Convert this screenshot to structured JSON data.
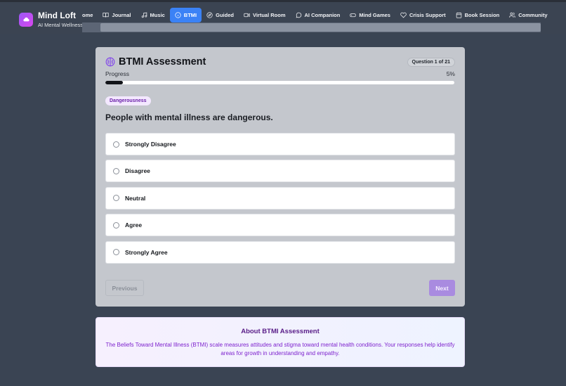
{
  "brand": {
    "title": "Mind Loft",
    "subtitle": "AI Mental Wellness"
  },
  "nav": {
    "items": [
      {
        "label": "ome",
        "icon": "home-icon"
      },
      {
        "label": "Journal",
        "icon": "book-icon"
      },
      {
        "label": "Music",
        "icon": "music-icon"
      },
      {
        "label": "BTMI",
        "icon": "info-icon",
        "active": true
      },
      {
        "label": "Guided",
        "icon": "compass-icon"
      },
      {
        "label": "Virtual Room",
        "icon": "video-icon"
      },
      {
        "label": "AI Companion",
        "icon": "chat-icon"
      },
      {
        "label": "Mind Games",
        "icon": "gamepad-icon"
      },
      {
        "label": "Crisis Support",
        "icon": "heart-icon"
      },
      {
        "label": "Book Session",
        "icon": "calendar-icon"
      },
      {
        "label": "Community",
        "icon": "users-icon"
      }
    ]
  },
  "assessment": {
    "title": "BTMI Assessment",
    "question_counter": "Question 1 of 21",
    "progress_label": "Progress",
    "progress_text": "5%",
    "progress_fraction": 0.05,
    "category": "Dangerousness",
    "question": "People with mental illness are dangerous.",
    "options": [
      "Strongly Disagree",
      "Disagree",
      "Neutral",
      "Agree",
      "Strongly Agree"
    ],
    "previous_label": "Previous",
    "next_label": "Next"
  },
  "about": {
    "title": "About BTMI Assessment",
    "text": "The Beliefs Toward Mental Illness (BTMI) scale measures attitudes and stigma toward mental health conditions. Your responses help identify areas for growth in understanding and empathy."
  },
  "colors": {
    "accent": "#3b82f6",
    "brand_purple": "#7c3aed",
    "next_button": "#a98be0",
    "about_text": "#7e22ce"
  }
}
